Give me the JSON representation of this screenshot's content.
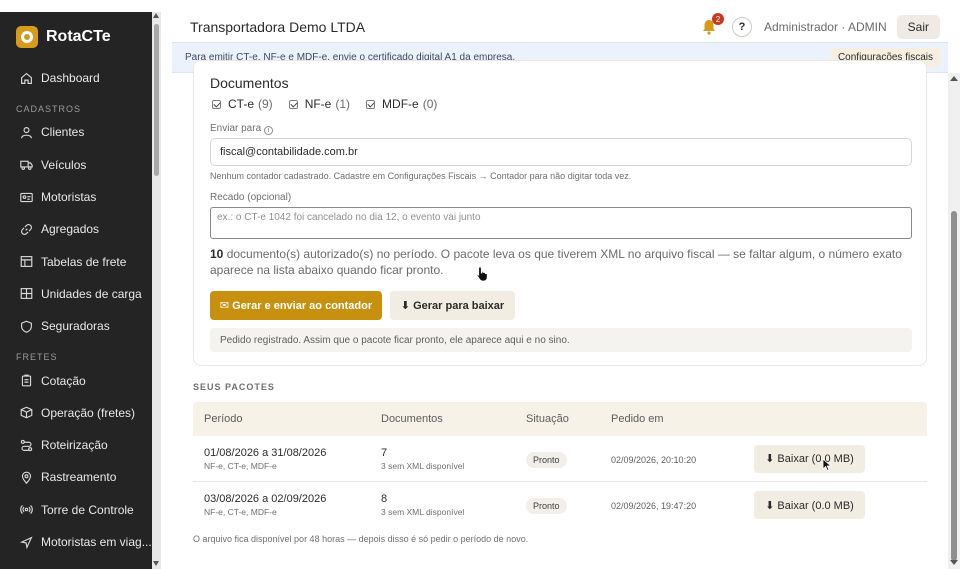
{
  "app": {
    "name": "RotaCTe",
    "company": "Transportadora Demo LTDA",
    "notifications_count": "2",
    "help_label": "?",
    "user_label": "Administrador · ADMIN",
    "logout_label": "Sair"
  },
  "sidebar": {
    "dashboard": "Dashboard",
    "cadastros_title": "CADASTROS",
    "cadastros": [
      "Clientes",
      "Veículos",
      "Motoristas",
      "Agregados",
      "Tabelas de frete",
      "Unidades de carga",
      "Seguradoras"
    ],
    "fretes_title": "FRETES",
    "fretes": [
      "Cotação",
      "Operação (fretes)",
      "Roteirização",
      "Rastreamento",
      "Torre de Controle",
      "Motoristas em viag..."
    ]
  },
  "banner": {
    "text": "Para emitir CT-e, NF-e e MDF-e, envie o certificado digital A1 da empresa.",
    "button": "Configurações fiscais"
  },
  "form": {
    "documents_title": "Documentos",
    "doc_types": [
      {
        "label": "CT-e",
        "count": "(9)"
      },
      {
        "label": "NF-e",
        "count": "(1)"
      },
      {
        "label": "MDF-e",
        "count": "(0)"
      }
    ],
    "send_to_label": "Enviar para",
    "info_icon": "i",
    "email_value": "fiscal@contabilidade.com.br",
    "contact_hint": "Nenhum contador cadastrado. Cadastre em Configurações Fiscais → Contador para não digitar toda vez.",
    "note_label": "Recado (opcional)",
    "note_placeholder": "ex.: o CT-e 1042 foi cancelado no dia 12, o evento vai junto",
    "summary_count": "10",
    "summary_text": " documento(s) autorizado(s) no período. O pacote leva os que tiverem XML no arquivo fiscal — se faltar algum, o número exato aparece na lista abaixo quando ficar pronto.",
    "send_button": "✉ Gerar e enviar ao contador",
    "download_button": "⬇ Gerar para baixar",
    "status_message": "Pedido registrado. Assim que o pacote ficar pronto, ele aparece aqui e no sino."
  },
  "packages": {
    "section_title": "SEUS PACOTES",
    "columns": [
      "Período",
      "Documentos",
      "Situação",
      "Pedido em",
      ""
    ],
    "rows": [
      {
        "period": "01/08/2026 a 31/08/2026",
        "types": "NF-e, CT-e, MDF-e",
        "docs": "7",
        "docs_note": "3 sem XML disponível",
        "status": "Pronto",
        "requested": "02/09/2026, 20:10:20",
        "action": "⬇ Baixar (0.0 MB)"
      },
      {
        "period": "03/08/2026 a 02/09/2026",
        "types": "NF-e, CT-e, MDF-e",
        "docs": "8",
        "docs_note": "3 sem XML disponível",
        "status": "Pronto",
        "requested": "02/09/2026, 19:47:20",
        "action": "⬇ Baixar (0.0 MB)"
      }
    ],
    "footer_note": "O arquivo fica disponível por 48 horas — depois disso é só pedir o período de novo."
  },
  "colors": {
    "sidebar_bg": "#252424",
    "brand_accent": "#d69b1b",
    "primary_button": "#c8900f",
    "banner_bg": "#ecf2fc",
    "badge_red": "#c9391f"
  }
}
